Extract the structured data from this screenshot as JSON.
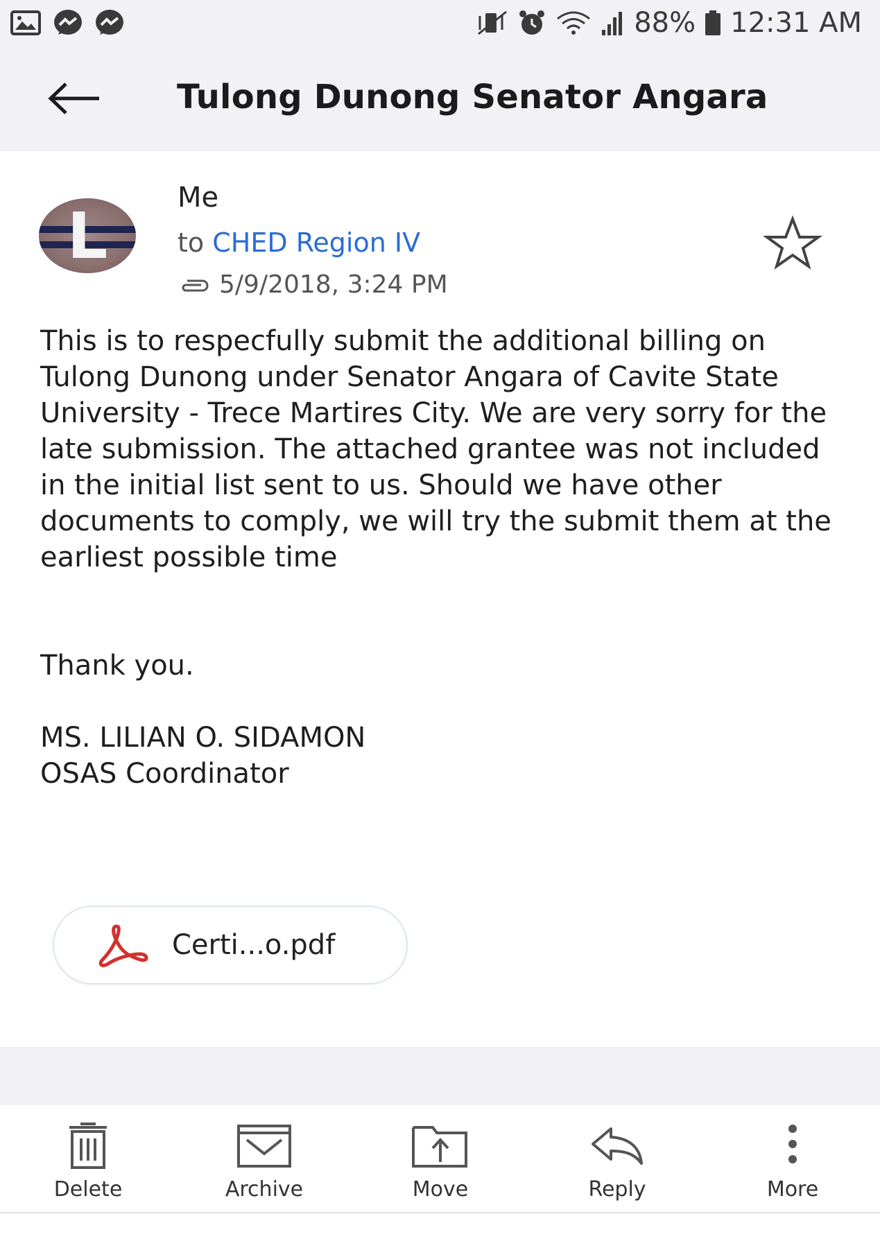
{
  "status_bar": {
    "battery": "88%",
    "time": "12:31 AM",
    "icons_left": [
      "image-icon",
      "messenger-icon",
      "messenger-icon"
    ],
    "icons_right": [
      "vibrate-icon",
      "alarm-icon",
      "wifi-icon",
      "signal-icon",
      "battery-icon"
    ]
  },
  "header": {
    "title": "Tulong Dunong Senator Angara",
    "back_icon": "arrow-left-icon"
  },
  "message": {
    "avatar_letter": "L",
    "sender": "Me",
    "to_prefix": "to",
    "recipient": "CHED Region IV",
    "date": "5/9/2018, 3:24 PM",
    "attachment_icon": "paperclip-icon",
    "star_icon": "star-icon",
    "body": "This is to respecfully submit the additional billing on Tulong Dunong under Senator Angara of Cavite State University - Trece Martires City. We are very sorry for the late submission. The attached grantee was not included in the initial list sent to us. Should we have other documents to comply, we will try the submit them at the earliest possible time",
    "closing": "Thank you.",
    "signature_name": "MS. LILIAN O. SIDAMON",
    "signature_title": "OSAS Coordinator"
  },
  "attachment": {
    "name": "Certi...o.pdf",
    "icon": "pdf-icon",
    "icon_color": "#d0312d"
  },
  "toolbar": {
    "items": [
      {
        "label": "Delete",
        "icon": "trash-icon"
      },
      {
        "label": "Archive",
        "icon": "archive-icon"
      },
      {
        "label": "Move",
        "icon": "move-icon"
      },
      {
        "label": "Reply",
        "icon": "reply-icon"
      },
      {
        "label": "More",
        "icon": "more-icon"
      }
    ]
  },
  "colors": {
    "link_blue": "#2a6cd6",
    "header_bg": "#f2f2f4"
  }
}
